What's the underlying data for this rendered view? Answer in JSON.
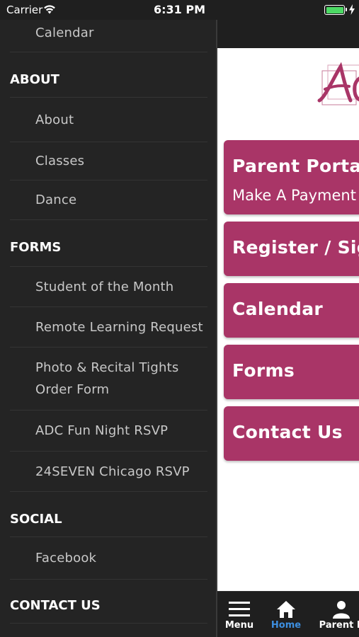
{
  "status_bar": {
    "carrier": "Carrier",
    "time": "6:31 PM"
  },
  "side_menu": {
    "items": [
      {
        "type": "item",
        "label": "Calendar"
      },
      {
        "type": "header",
        "label": "ABOUT"
      },
      {
        "type": "item",
        "label": "About"
      },
      {
        "type": "item",
        "label": "Classes"
      },
      {
        "type": "item",
        "label": "Dance"
      },
      {
        "type": "header",
        "label": "FORMS"
      },
      {
        "type": "item",
        "label": "Student of the Month"
      },
      {
        "type": "item",
        "label": "Remote Learning Request"
      },
      {
        "type": "item",
        "label": "Photo & Recital Tights Order Form"
      },
      {
        "type": "item",
        "label": "ADC Fun Night RSVP"
      },
      {
        "type": "item",
        "label": "24SEVEN Chicago RSVP"
      },
      {
        "type": "header",
        "label": "SOCIAL"
      },
      {
        "type": "item",
        "label": "Facebook"
      },
      {
        "type": "header",
        "label": "CONTACT US"
      }
    ]
  },
  "main": {
    "buttons": [
      {
        "title": "Parent Portal",
        "subtitle": "Make A Payment /"
      },
      {
        "title": "Register / Sign",
        "subtitle": ""
      },
      {
        "title": "Calendar",
        "subtitle": ""
      },
      {
        "title": "Forms",
        "subtitle": ""
      },
      {
        "title": "Contact Us",
        "subtitle": ""
      }
    ]
  },
  "tab_bar": {
    "tabs": [
      {
        "label": "Menu",
        "icon": "hamburger-icon"
      },
      {
        "label": "Home",
        "icon": "home-icon",
        "active": true
      },
      {
        "label": "Parent P",
        "icon": "person-icon"
      }
    ]
  },
  "colors": {
    "accent": "#a93567",
    "active_tab": "#3d8fe0",
    "menu_bg": "#242424"
  }
}
